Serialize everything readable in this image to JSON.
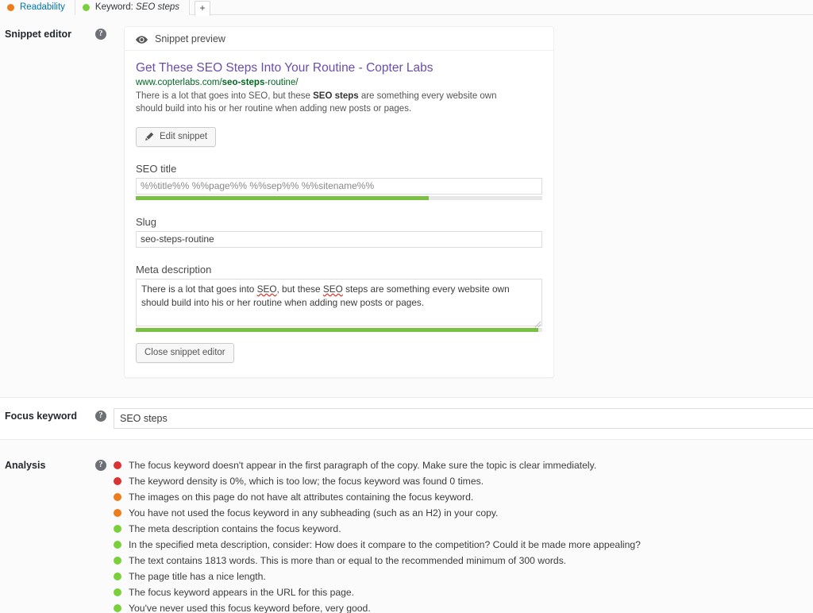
{
  "tabs": [
    {
      "id": "readability",
      "label": "Readability",
      "status_color": "#ee7c1b",
      "status": "orange",
      "icon": "status-dot-icon"
    },
    {
      "id": "keyword",
      "label": "Keyword:",
      "value": "SEO steps",
      "status_color": "#7ad03a",
      "status": "green",
      "icon": "status-dot-icon"
    }
  ],
  "tab_add_label": "+",
  "snippet_editor": {
    "row_label": "Snippet editor",
    "help_glyph": "?",
    "preview_header": "Snippet preview",
    "preview_icon": "eye-icon",
    "serp": {
      "title": "Get These SEO Steps Into Your Routine - Copter Labs",
      "url_prefix": "www.copterlabs.com/",
      "url_bold": "seo-steps",
      "url_suffix": "-routine/",
      "description_part1": "There is a lot that goes into SEO, but these ",
      "description_bold": "SEO steps",
      "description_part2": " are something every website own should build into his or her routine when adding new posts or pages."
    },
    "edit_button": "Edit snippet",
    "edit_button_icon": "pencil-icon",
    "close_button": "Close snippet editor",
    "seo_title": {
      "label": "SEO title",
      "value": "%%title%% %%page%% %%sep%% %%sitename%%",
      "placeholder": "%%title%% %%page%% %%sep%% %%sitename%%",
      "progress_percent": 72,
      "progress_color": "#7ac143"
    },
    "slug": {
      "label": "Slug",
      "value": "seo-steps-routine",
      "placeholder": "seo-steps-routine"
    },
    "meta_description": {
      "label": "Meta description",
      "value": "There is a lot that goes into SEO, but these SEO steps are something every website own should build into his or her routine when adding new posts or pages.",
      "line1_a": "There is a lot that goes into ",
      "line1_misspelled_1": "SEO",
      "line1_b": ", but these ",
      "line1_misspelled_2": "SEO",
      "line1_c": " steps are something every website own",
      "line2": "should build into his or her routine when adding new posts or pages.",
      "progress_percent": 99,
      "progress_color": "#7ac143"
    }
  },
  "focus_keyword": {
    "row_label": "Focus keyword",
    "help_glyph": "?",
    "value": "SEO steps",
    "placeholder": "SEO steps"
  },
  "analysis": {
    "row_label": "Analysis",
    "help_glyph": "?",
    "items": [
      {
        "status": "red",
        "color": "#dc3232",
        "text": "The focus keyword doesn't appear in the first paragraph of the copy. Make sure the topic is clear immediately."
      },
      {
        "status": "red",
        "color": "#dc3232",
        "text": "The keyword density is 0%, which is too low; the focus keyword was found 0 times."
      },
      {
        "status": "orange",
        "color": "#ee7c1b",
        "text": "The images on this page do not have alt attributes containing the focus keyword."
      },
      {
        "status": "orange",
        "color": "#ee7c1b",
        "text": "You have not used the focus keyword in any subheading (such as an H2) in your copy."
      },
      {
        "status": "green",
        "color": "#7ad03a",
        "text": "The meta description contains the focus keyword."
      },
      {
        "status": "green",
        "color": "#7ad03a",
        "text": "In the specified meta description, consider: How does it compare to the competition? Could it be made more appealing?"
      },
      {
        "status": "green",
        "color": "#7ad03a",
        "text": "The text contains 1813 words. This is more than or equal to the recommended minimum of 300 words."
      },
      {
        "status": "green",
        "color": "#7ad03a",
        "text": "The page title has a nice length."
      },
      {
        "status": "green",
        "color": "#7ad03a",
        "text": "The focus keyword appears in the URL for this page."
      },
      {
        "status": "green",
        "color": "#7ad03a",
        "text": "You've never used this focus keyword before, very good."
      }
    ]
  }
}
